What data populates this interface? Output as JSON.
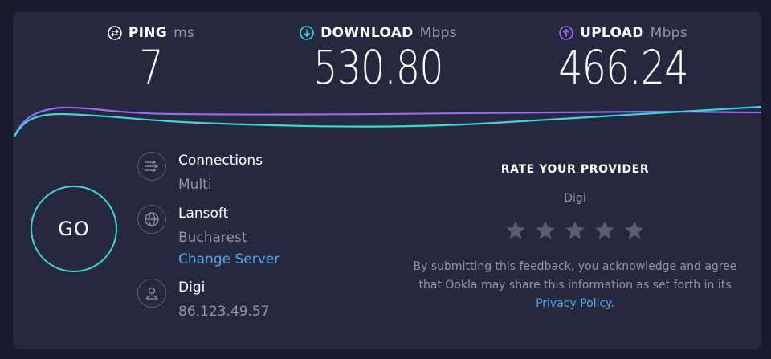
{
  "ping": {
    "label": "PING",
    "unit": "ms",
    "value": "7",
    "icon": "ping-gauge-icon"
  },
  "download": {
    "label": "DOWNLOAD",
    "unit": "Mbps",
    "value": "530.80",
    "icon": "download-arrow-icon"
  },
  "upload": {
    "label": "UPLOAD",
    "unit": "Mbps",
    "value": "466.24",
    "icon": "upload-arrow-icon"
  },
  "go_label": "GO",
  "connections": {
    "title": "Connections",
    "value": "Multi",
    "icon": "connections-icon"
  },
  "server": {
    "name": "Lansoft",
    "location": "Bucharest",
    "change_label": "Change Server",
    "icon": "globe-icon"
  },
  "isp": {
    "name": "Digi",
    "ip": "86.123.49.57",
    "icon": "user-icon"
  },
  "rate": {
    "title": "RATE YOUR PROVIDER",
    "provider": "Digi",
    "stars_total": 5,
    "stars_selected": 0,
    "disclaimer_text": "By submitting this feedback, you acknowledge and agree that Ookla may share this information as set forth in its",
    "privacy_label": "Privacy Policy",
    "disclaimer_end": "."
  },
  "colors": {
    "background": "#191a2e",
    "panel": "#26283f",
    "download_accent": "#3fd6d6",
    "upload_accent": "#9b6cf0",
    "link": "#4fa8e8",
    "muted_text": "#9193a8"
  }
}
